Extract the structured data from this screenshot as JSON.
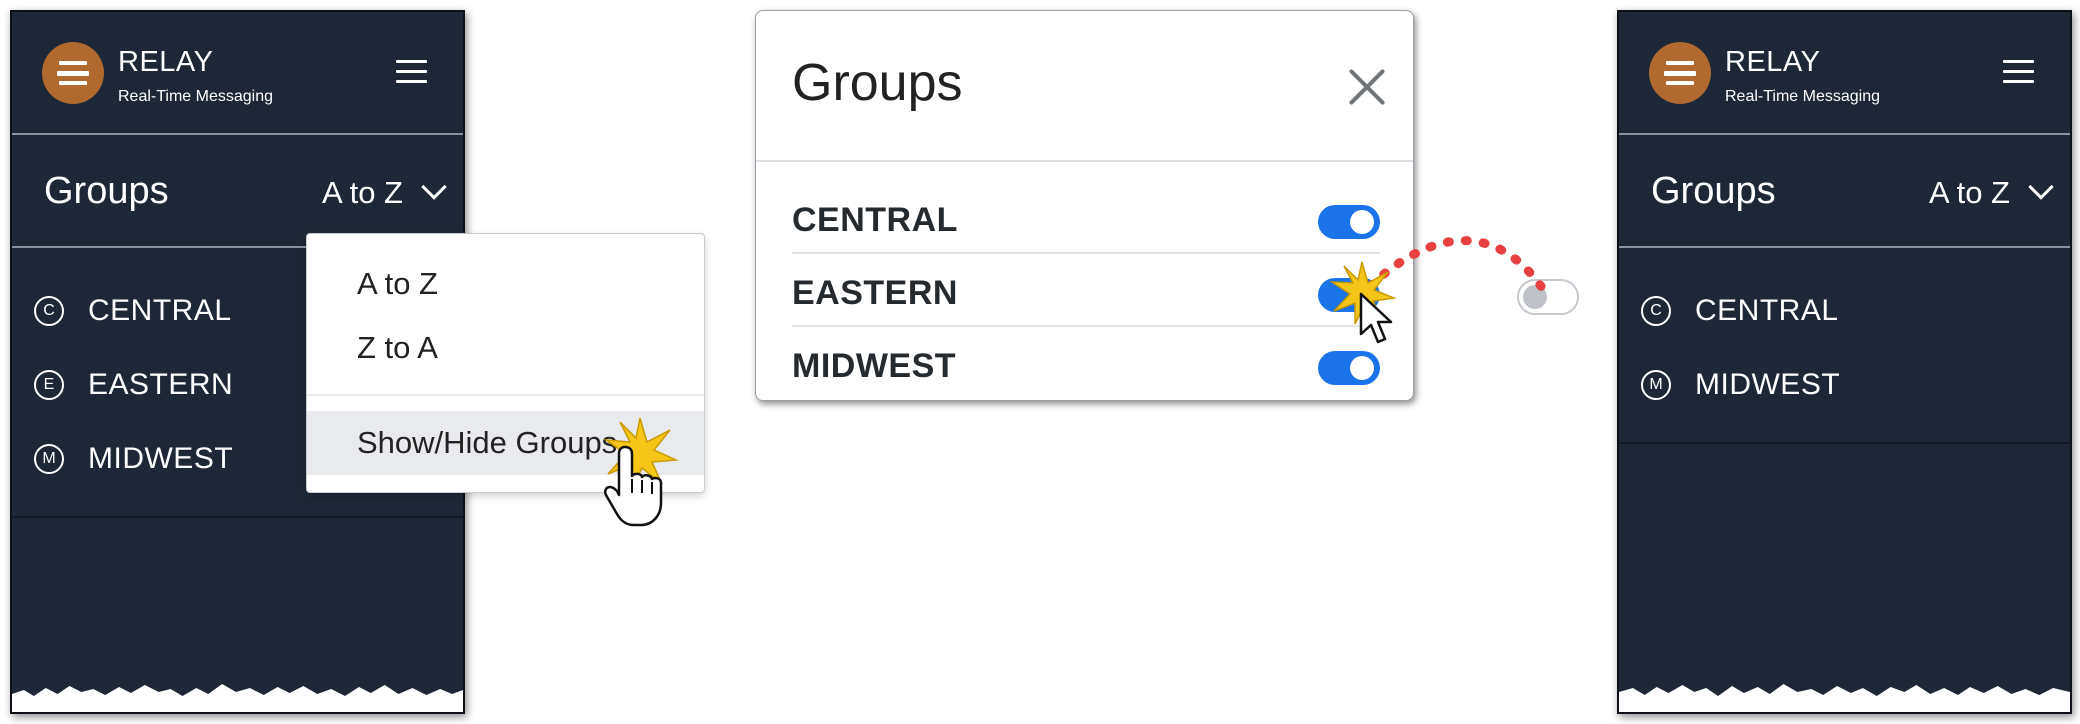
{
  "app": {
    "title": "RELAY",
    "subtitle": "Real-Time Messaging"
  },
  "left_panel": {
    "groups_title": "Groups",
    "sort_value": "A to Z",
    "groups": [
      {
        "badge": "C",
        "label": "CENTRAL"
      },
      {
        "badge": "E",
        "label": "EASTERN"
      },
      {
        "badge": "M",
        "label": "MIDWEST"
      }
    ]
  },
  "sort_menu": {
    "items": [
      "A to Z",
      "Z to A"
    ],
    "action": "Show/Hide Groups"
  },
  "modal": {
    "title": "Groups",
    "rows": [
      {
        "label": "CENTRAL",
        "enabled": true
      },
      {
        "label": "EASTERN",
        "enabled": true
      },
      {
        "label": "MIDWEST",
        "enabled": true
      }
    ]
  },
  "right_panel": {
    "groups_title": "Groups",
    "sort_value": "A to Z",
    "groups": [
      {
        "badge": "C",
        "label": "CENTRAL"
      },
      {
        "badge": "M",
        "label": "MIDWEST"
      }
    ]
  },
  "colors": {
    "panel_bg": "#1e2735",
    "logo": "#b06a30",
    "toggle_on": "#1a73e8",
    "annotation_path": "#e84040",
    "click_burst": "#f5c518"
  },
  "icons": {
    "logo": "relay-logo-icon",
    "menu": "hamburger-menu-icon",
    "sort": "chevron-down-icon",
    "close": "close-icon",
    "cursor_hand": "hand-pointer-icon",
    "cursor_arrow": "arrow-pointer-icon"
  }
}
